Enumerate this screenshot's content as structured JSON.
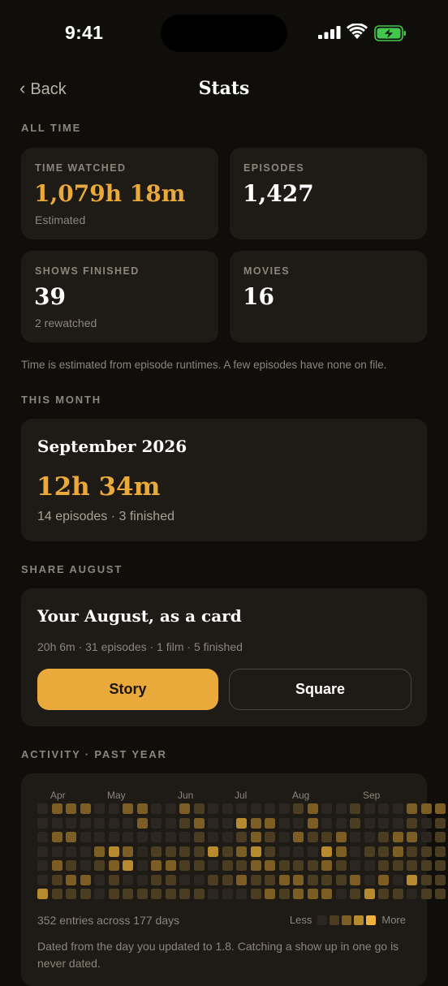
{
  "status_bar": {
    "time": "9:41"
  },
  "nav": {
    "back_label": "Back",
    "title": "Stats"
  },
  "all_time": {
    "section_label": "ALL TIME",
    "cards": [
      {
        "label": "TIME WATCHED",
        "value": "1,079h 18m",
        "sub": "Estimated",
        "accent": true
      },
      {
        "label": "EPISODES",
        "value": "1,427",
        "sub": ""
      },
      {
        "label": "SHOWS FINISHED",
        "value": "39",
        "sub": "2 rewatched"
      },
      {
        "label": "MOVIES",
        "value": "16",
        "sub": ""
      }
    ],
    "note": "Time is estimated from episode runtimes. A few episodes have none on file."
  },
  "this_month": {
    "section_label": "THIS MONTH",
    "title": "September 2026",
    "time": "12h 34m",
    "summary": "14 episodes · 3 finished"
  },
  "share": {
    "section_label": "SHARE AUGUST",
    "title": "Your August, as a card",
    "summary": "20h 6m · 31 episodes · 1 film · 5 finished",
    "story_label": "Story",
    "square_label": "Square"
  },
  "activity": {
    "section_label": "ACTIVITY · PAST YEAR",
    "months": [
      "Apr",
      "May",
      "Jun",
      "Jul",
      "Aug",
      "Sep"
    ],
    "weeks": [
      [
        0,
        0,
        0,
        0,
        0,
        0,
        3
      ],
      [
        2,
        0,
        2,
        0,
        2,
        1,
        1
      ],
      [
        2,
        0,
        2,
        0,
        1,
        2,
        1
      ],
      [
        2,
        0,
        0,
        0,
        0,
        2,
        1
      ],
      [
        0,
        0,
        0,
        2,
        1,
        0,
        0
      ],
      [
        0,
        0,
        0,
        3,
        2,
        1,
        1
      ],
      [
        2,
        0,
        0,
        2,
        3,
        0,
        1
      ],
      [
        2,
        2,
        0,
        0,
        0,
        0,
        1
      ],
      [
        0,
        0,
        0,
        1,
        2,
        1,
        1
      ],
      [
        0,
        0,
        0,
        1,
        2,
        1,
        1
      ],
      [
        2,
        1,
        0,
        1,
        1,
        0,
        1
      ],
      [
        1,
        2,
        1,
        1,
        1,
        0,
        1
      ],
      [
        0,
        0,
        0,
        3,
        0,
        1,
        0
      ],
      [
        0,
        0,
        0,
        1,
        1,
        1,
        0
      ],
      [
        0,
        3,
        1,
        2,
        1,
        2,
        0
      ],
      [
        0,
        2,
        2,
        3,
        2,
        1,
        1
      ],
      [
        0,
        2,
        1,
        1,
        2,
        1,
        2
      ],
      [
        0,
        0,
        0,
        0,
        1,
        2,
        1
      ],
      [
        1,
        0,
        2,
        0,
        1,
        2,
        2
      ],
      [
        2,
        2,
        1,
        0,
        1,
        1,
        2
      ],
      [
        0,
        0,
        1,
        3,
        2,
        1,
        2
      ],
      [
        0,
        0,
        2,
        2,
        1,
        1,
        0
      ],
      [
        1,
        1,
        0,
        0,
        0,
        2,
        1
      ],
      [
        0,
        0,
        0,
        1,
        0,
        0,
        3
      ],
      [
        0,
        0,
        1,
        1,
        1,
        2,
        1
      ],
      [
        0,
        0,
        2,
        2,
        1,
        0,
        1
      ],
      [
        2,
        1,
        2,
        1,
        1,
        3,
        0
      ],
      [
        2,
        0,
        0,
        1,
        1,
        1,
        1
      ],
      [
        2,
        1,
        1,
        1,
        1,
        1,
        1
      ],
      [
        4
      ]
    ],
    "entries_summary": "352 entries across 177 days",
    "legend_less": "Less",
    "legend_more": "More",
    "note": "Dated from the day you updated to 1.8. Catching a show up in one go is never dated."
  },
  "colors": {
    "accent": "#e9a93b",
    "background": "#100e0b",
    "card": "#1e1b16",
    "heat_levels": [
      "#2b2720",
      "#4a3d21",
      "#7c5e24",
      "#b88a2f",
      "#f0b23f"
    ]
  }
}
